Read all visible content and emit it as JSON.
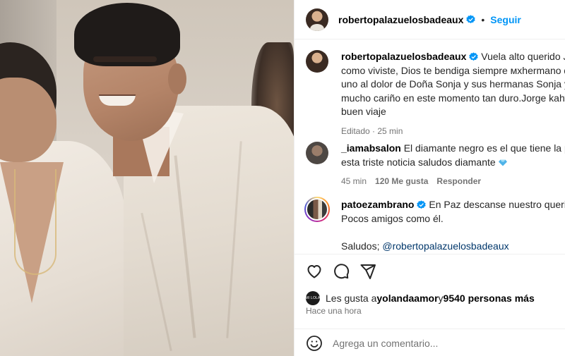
{
  "post": {
    "author": "robertopalazuelosbadeaux",
    "separator": "•",
    "follow_label": "Seguir"
  },
  "caption": {
    "username": "robertopalazuelosbadeaux",
    "lines": [
      "Vuela alto querido Jorge",
      "como viviste, Dios te bendiga siempre мхhermano que",
      "uno al dolor de Doña Sonja y sus hermanas Sonja y Lay",
      "mucho cariño en este momento tan duro.Jorge kahwag",
      "buen viaje"
    ],
    "meta": "Editado · 25 min"
  },
  "comment1": {
    "username": "_iamabsalon",
    "line1": "El diamante negro es el que tiene la primi",
    "line2": "esta triste noticia saludos diamante",
    "emoji": "gem-icon",
    "time": "45 min",
    "likes": "120 Me gusta",
    "reply": "Responder"
  },
  "comment2": {
    "username": "patoezambrano",
    "line1": "En Paz descanse nuestro querido Jo",
    "line2": "Pocos amigos como él.",
    "line3": "Saludos; ",
    "mention": "@robertopalazuelosbadeaux"
  },
  "actions": {
    "icons": [
      "heart-icon",
      "comment-icon",
      "share-icon"
    ],
    "likes_prefix": "Les gusta a ",
    "likes_user": "yolandaamor",
    "likes_mid": " y ",
    "likes_count": "9540 personas más",
    "liker_avatar_text": "MI LOLA",
    "time": "Hace una hora"
  },
  "comment_box": {
    "placeholder": "Agrega un comentario..."
  },
  "colors": {
    "accent": "#0095f6",
    "verified": "#0095f6",
    "muted": "#737373",
    "mention": "#00376b"
  }
}
